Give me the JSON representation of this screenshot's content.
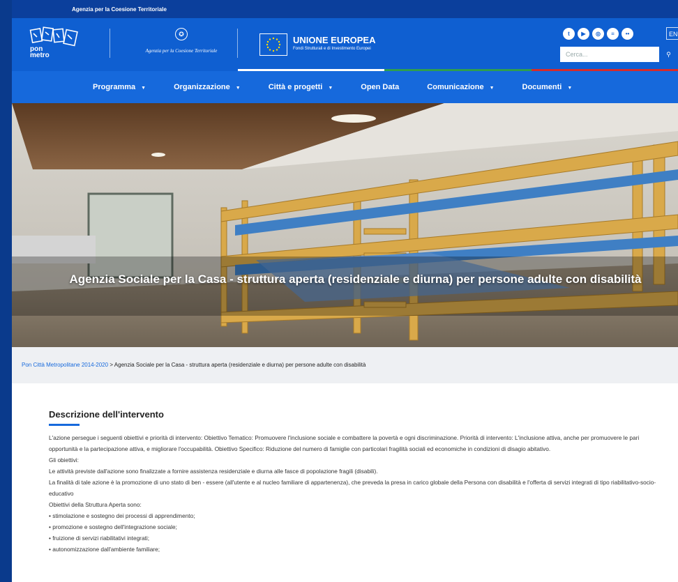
{
  "topbar": {
    "label": "Agenzia per la Coesione Territoriale"
  },
  "header": {
    "logo_text": "pon metro",
    "agency_text": "Agenzia per la Coesione Territoriale",
    "eu_title": "UNIONE EUROPEA",
    "eu_subtitle": "Fondi Strutturali e di Investimento Europei",
    "social": [
      {
        "icon": "twitter-icon",
        "glyph": "t"
      },
      {
        "icon": "youtube-icon",
        "glyph": "▶"
      },
      {
        "icon": "instagram-icon",
        "glyph": "◎"
      },
      {
        "icon": "rss-icon",
        "glyph": "≡"
      },
      {
        "icon": "flickr-icon",
        "glyph": "••"
      }
    ],
    "lang": "EN",
    "search_placeholder": "Cerca..."
  },
  "nav": {
    "items": [
      {
        "label": "Programma",
        "dropdown": true
      },
      {
        "label": "Organizzazione",
        "dropdown": true
      },
      {
        "label": "Città e progetti",
        "dropdown": true
      },
      {
        "label": "Open Data",
        "dropdown": false
      },
      {
        "label": "Comunicazione",
        "dropdown": true
      },
      {
        "label": "Documenti",
        "dropdown": true
      }
    ]
  },
  "hero": {
    "title": "Agenzia Sociale per la Casa - struttura aperta (residenziale e diurna) per persone adulte con disabilità"
  },
  "breadcrumb": {
    "home": "Pon Città Metropolitane 2014-2020",
    "separator": " > ",
    "current": "Agenzia Sociale per la Casa - struttura aperta (residenziale e diurna) per persone adulte con disabilità"
  },
  "content": {
    "heading": "Descrizione dell'intervento",
    "p1": "L'azione persegue i seguenti obiettivi e priorità di intervento: Obiettivo Tematico: Promuovere l'inclusione sociale e combattere la povertà e ogni discriminazione. Priorità di intervento: L'inclusione attiva, anche per promuovere le pari opportunità e la partecipazione attiva, e migliorare l'occupabilità. Obiettivo Specifico: Riduzione del numero di famiglie con particolari fragilità sociali ed economiche in condizioni di disagio abitativo.",
    "p2": "Gli obiettivi:",
    "p3": "Le attività previste dall'azione sono finalizzate a fornire assistenza residenziale e diurna alle fasce di popolazione fragili (disabili).",
    "p4": "La finalità di tale azione è la promozione di uno stato di ben - essere (all'utente e al nucleo familiare di appartenenza), che preveda la presa in carico globale della Persona con disabilità e l'offerta di servizi integrati di tipo riabilitativo-socio-educativo",
    "p5": "Obiettivi della Struttura Aperta sono:",
    "bullets": [
      "stimolazione e sostegno dei processi di apprendimento;",
      "promozione e sostegno dell'integrazione sociale;",
      "fruizione di servizi riabilitativi integrati;",
      "autonomizzazione dall'ambiente familiare;"
    ]
  },
  "colors": {
    "primary": "#0f5fd1",
    "nav": "#1669dc",
    "topbar": "#0b3f9c",
    "accent_green": "#2e9e4f",
    "accent_red": "#d62b2b"
  }
}
